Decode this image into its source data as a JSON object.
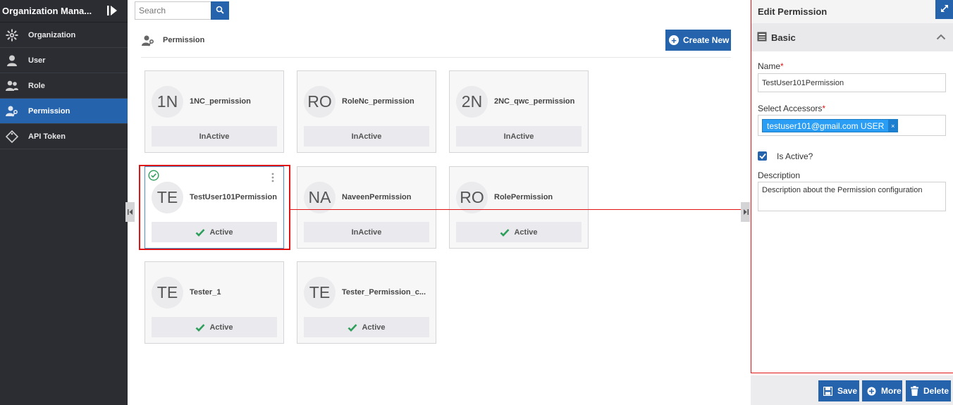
{
  "sidebar": {
    "title": "Organization Mana...",
    "items": [
      {
        "label": "Organization",
        "icon": "gear-icon"
      },
      {
        "label": "User",
        "icon": "user-icon"
      },
      {
        "label": "Role",
        "icon": "users-icon"
      },
      {
        "label": "Permission",
        "icon": "user-key-icon",
        "active": true
      },
      {
        "label": "API Token",
        "icon": "tag-icon"
      }
    ]
  },
  "search": {
    "placeholder": "Search",
    "value": ""
  },
  "page": {
    "title": "Permission",
    "create_label": "Create New"
  },
  "cards": [
    {
      "initials": "1N",
      "name": "1NC_permission",
      "status": "InActive"
    },
    {
      "initials": "RO",
      "name": "RoleNc_permission",
      "status": "InActive"
    },
    {
      "initials": "2N",
      "name": "2NC_qwc_permission",
      "status": "InActive"
    },
    {
      "initials": "TE",
      "name": "TestUser101Permission",
      "status": "Active",
      "selected": true
    },
    {
      "initials": "NA",
      "name": "NaveenPermission",
      "status": "InActive"
    },
    {
      "initials": "RO",
      "name": "RolePermission",
      "status": "Active"
    },
    {
      "initials": "TE",
      "name": "Tester_1",
      "status": "Active"
    },
    {
      "initials": "TE",
      "name": "Tester_Permission_c...",
      "status": "Active"
    }
  ],
  "panel": {
    "title": "Edit Permission",
    "section": "Basic",
    "name_label": "Name",
    "required_mark": "*",
    "name_value": "TestUser101Permission",
    "accessors_label": "Select Accessors",
    "accessor_tag": "testuser101@gmail.com USER",
    "tag_remove": "×",
    "is_active_label": "Is Active?",
    "is_active": true,
    "description_label": "Description",
    "description_value": "Description about the Permission configuration"
  },
  "footer": {
    "save": "Save",
    "more": "More",
    "delete": "Delete"
  },
  "colors": {
    "primary": "#2563ad",
    "sidebar": "#2b2d33",
    "active_check": "#2e9e5b",
    "highlight": "#e01414",
    "tag": "#2a9df4"
  }
}
